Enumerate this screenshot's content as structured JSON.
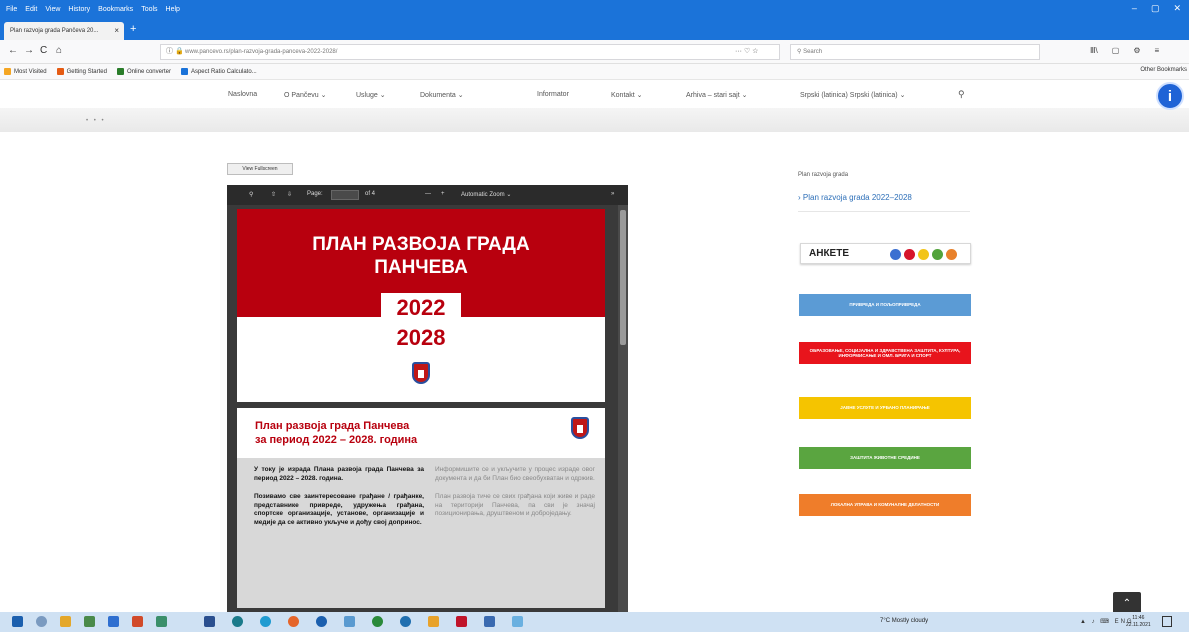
{
  "browser": {
    "menu": [
      "File",
      "Edit",
      "View",
      "History",
      "Bookmarks",
      "Tools",
      "Help"
    ],
    "tab_title": "Plan razvoja grada Pančeva 20...",
    "new_tab": "+",
    "back": "←",
    "forward": "→",
    "reload": "C",
    "home": "⌂",
    "url": "www.pancevo.rs/plan-razvoja-grada-panceva-2022-2028/",
    "url_more": "··· ♡ ☆",
    "search_placeholder": "Search",
    "toolbar_right": [
      "Ⅲ\\",
      "▢",
      "⚙",
      "≡"
    ],
    "bookmarks": [
      {
        "label": "Most Visited",
        "color": "#f5a623"
      },
      {
        "label": "Getting Started",
        "color": "#e55b13"
      },
      {
        "label": "Online converter",
        "color": "#2a7d2a"
      },
      {
        "label": "Aspect Ratio Calculato...",
        "color": "#1b73d9"
      }
    ],
    "other_bookmarks": "Other Bookmarks",
    "window_controls": [
      "–",
      "▢",
      "✕"
    ]
  },
  "site": {
    "nav": [
      "Naslovna",
      "O Pančevu ⌄",
      "Usluge ⌄",
      "Dokumenta ⌄",
      "Informator",
      "Kontakt ⌄",
      "Arhiva – stari sajt ⌄",
      "Srpski (latinica) Srpski (latinica) ⌄"
    ],
    "search_icon": "⚲",
    "dots": "• • •",
    "info_icon": "i"
  },
  "pdf": {
    "view_fullscreen": "View Fullscreen",
    "toolbar": {
      "search": "⚲",
      "up": "⇧",
      "down": "⇩",
      "page_label": "Page:",
      "of": "of 4",
      "zoom_out": "—",
      "zoom_in": "+",
      "zoom": "Automatic Zoom ⌄",
      "more": "»"
    },
    "page1": {
      "title_line1": "ПЛАН РАЗВОЈА ГРАДА",
      "title_line2": "ПАНЧЕВА",
      "year1": "2022",
      "year2": "2028"
    },
    "page2": {
      "title_line1": "План развоја града Панчева",
      "title_line2": "за период 2022 – 2028. година",
      "left_p1": "У току је израда Плана развоја града Панчева за период 2022 – 2028. година.",
      "left_p2": "Позивамо све заинтересоване грађане / грађанке, представнике привреде, удружења грађана, спортске организације, установе, организације и медије да се активно укључе и дођу свој допринос.",
      "right_p1": "Информишите се и укључите у процес израде овог документа и да би План био свеобухватан и одржив.",
      "right_p2": "План развоја тиче се свих грађана који живе и раде на територији Панчева, па сви је значај позиционирања, друштвеном и доброједању."
    }
  },
  "sidebar": {
    "heading": "Plan razvoja grada",
    "link": "› Plan razvoja grada 2022–2028",
    "ankete": "АНКЕТЕ",
    "ankete_dots": [
      "#3b6fd1",
      "#d6152b",
      "#f2c417",
      "#52a33b",
      "#e8812b"
    ],
    "buttons": [
      {
        "label": "ПРИВРЕДА И ПОЉОПРИВРЕДА",
        "color": "#5b9bd5"
      },
      {
        "label": "ОБРАЗОВАЊЕ, СОЦИЈАЛНА И ЗДРАВСТВЕНА ЗАШТИТА, КУЛТУРА, ИНФОРМИСАЊЕ И ОМЛ. БРИГА И СПОРТ",
        "color": "#e8141c"
      },
      {
        "label": "ЈАВНЕ УСЛУГЕ И УРБАНО ПЛАНИРАЊЕ",
        "color": "#f5c400"
      },
      {
        "label": "ЗАШТИТА ЖИВОТНЕ СРЕДИНЕ",
        "color": "#5aa540"
      },
      {
        "label": "ЛОКАЛНА УПРАВА И КОМУНАЛНЕ ДЕЛАТНОСТИ",
        "color": "#ef7d2a"
      }
    ],
    "to_top": "⌃"
  },
  "taskbar": {
    "weather": "7°C  Mostly cloudy",
    "tray": "▲ ♪ ⌨ ENG",
    "time": "11:46",
    "date": "22.11.2021"
  }
}
